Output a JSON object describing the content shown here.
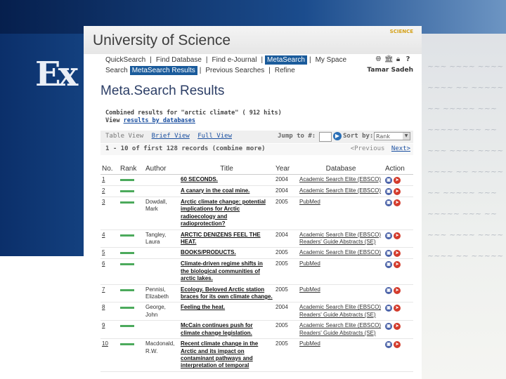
{
  "app": {
    "title": "University of Science",
    "brand_tag": "SCIENCE",
    "background_logo": "Ex"
  },
  "nav": {
    "row1": [
      "QuickSearch",
      "Find Database",
      "Find e-Journal",
      "MetaSearch",
      "My Space"
    ],
    "row2": [
      "Search",
      "MetaSearch Results",
      "Previous Searches",
      "Refine"
    ],
    "active_row1": "MetaSearch",
    "active_row2": "MetaSearch Results",
    "user": "Tamar Sadeh",
    "icons": [
      "globe-icon",
      "library-icon",
      "lock-icon",
      "help-icon"
    ]
  },
  "page": {
    "title": "Meta.Search Results",
    "summary_line1": "Combined results for \"arctic climate\" ( 912 hits)",
    "summary_view": "View",
    "summary_link": "results by databases"
  },
  "toolbar": {
    "views": [
      "Table View",
      "Brief View",
      "Full View"
    ],
    "jump_label": "Jump to #:",
    "jump_value": "",
    "sort_label": "Sort by:",
    "sort_value": "Rank"
  },
  "pager": {
    "range": "1 - 10 of first 128 records (combine more)",
    "prev": "<Previous",
    "next": "Next>"
  },
  "table": {
    "headers": [
      "No.",
      "Rank",
      "Author",
      "Title",
      "Year",
      "Database",
      "Action"
    ],
    "rows": [
      {
        "no": "1",
        "author": "",
        "title": "60 SECONDS.",
        "year": "2004",
        "db": "Academic Search Elite (EBSCO)"
      },
      {
        "no": "2",
        "author": "",
        "title": "A canary in the coal mine.",
        "year": "2004",
        "db": "Academic Search Elite (EBSCO)"
      },
      {
        "no": "3",
        "author": "Dowdall, Mark",
        "title": "Arctic climate change: potential implications for Arctic radioecology and radioprotection?",
        "year": "2005",
        "db": "PubMed"
      },
      {
        "no": "4",
        "author": "Tangley, Laura",
        "title": "ARCTIC DENIZENS FEEL THE HEAT.",
        "year": "2004",
        "db": "Academic Search Elite (EBSCO)\nReaders' Guide Abstracts (SE)"
      },
      {
        "no": "5",
        "author": "",
        "title": "BOOKS/PRODUCTS.",
        "year": "2005",
        "db": "Academic Search Elite (EBSCO)"
      },
      {
        "no": "6",
        "author": "",
        "title": "Climate-driven regime shifts in the biological communities of arctic lakes.",
        "year": "2005",
        "db": "PubMed"
      },
      {
        "no": "7",
        "author": "Pennisi, Elizabeth",
        "title": "Ecology. Beloved Arctic station braces for its own climate change.",
        "year": "2005",
        "db": "PubMed"
      },
      {
        "no": "8",
        "author": "George, John",
        "title": "Feeling the heat.",
        "year": "2004",
        "db": "Academic Search Elite (EBSCO)\nReaders' Guide Abstracts (SE)"
      },
      {
        "no": "9",
        "author": "",
        "title": "McCain continues push for climate change legislation.",
        "year": "2005",
        "db": "Academic Search Elite (EBSCO)\nReaders' Guide Abstracts (SE)"
      },
      {
        "no": "10",
        "author": "Macdonald, R.W.",
        "title": "Recent climate change in the Arctic and its impact on contaminant pathways and interpretation of temporal",
        "year": "2005",
        "db": "PubMed"
      }
    ]
  },
  "colors": {
    "nav_active": "#1a5b9b",
    "link": "#1a4fa0",
    "rank_bar": "#4caa5c"
  }
}
